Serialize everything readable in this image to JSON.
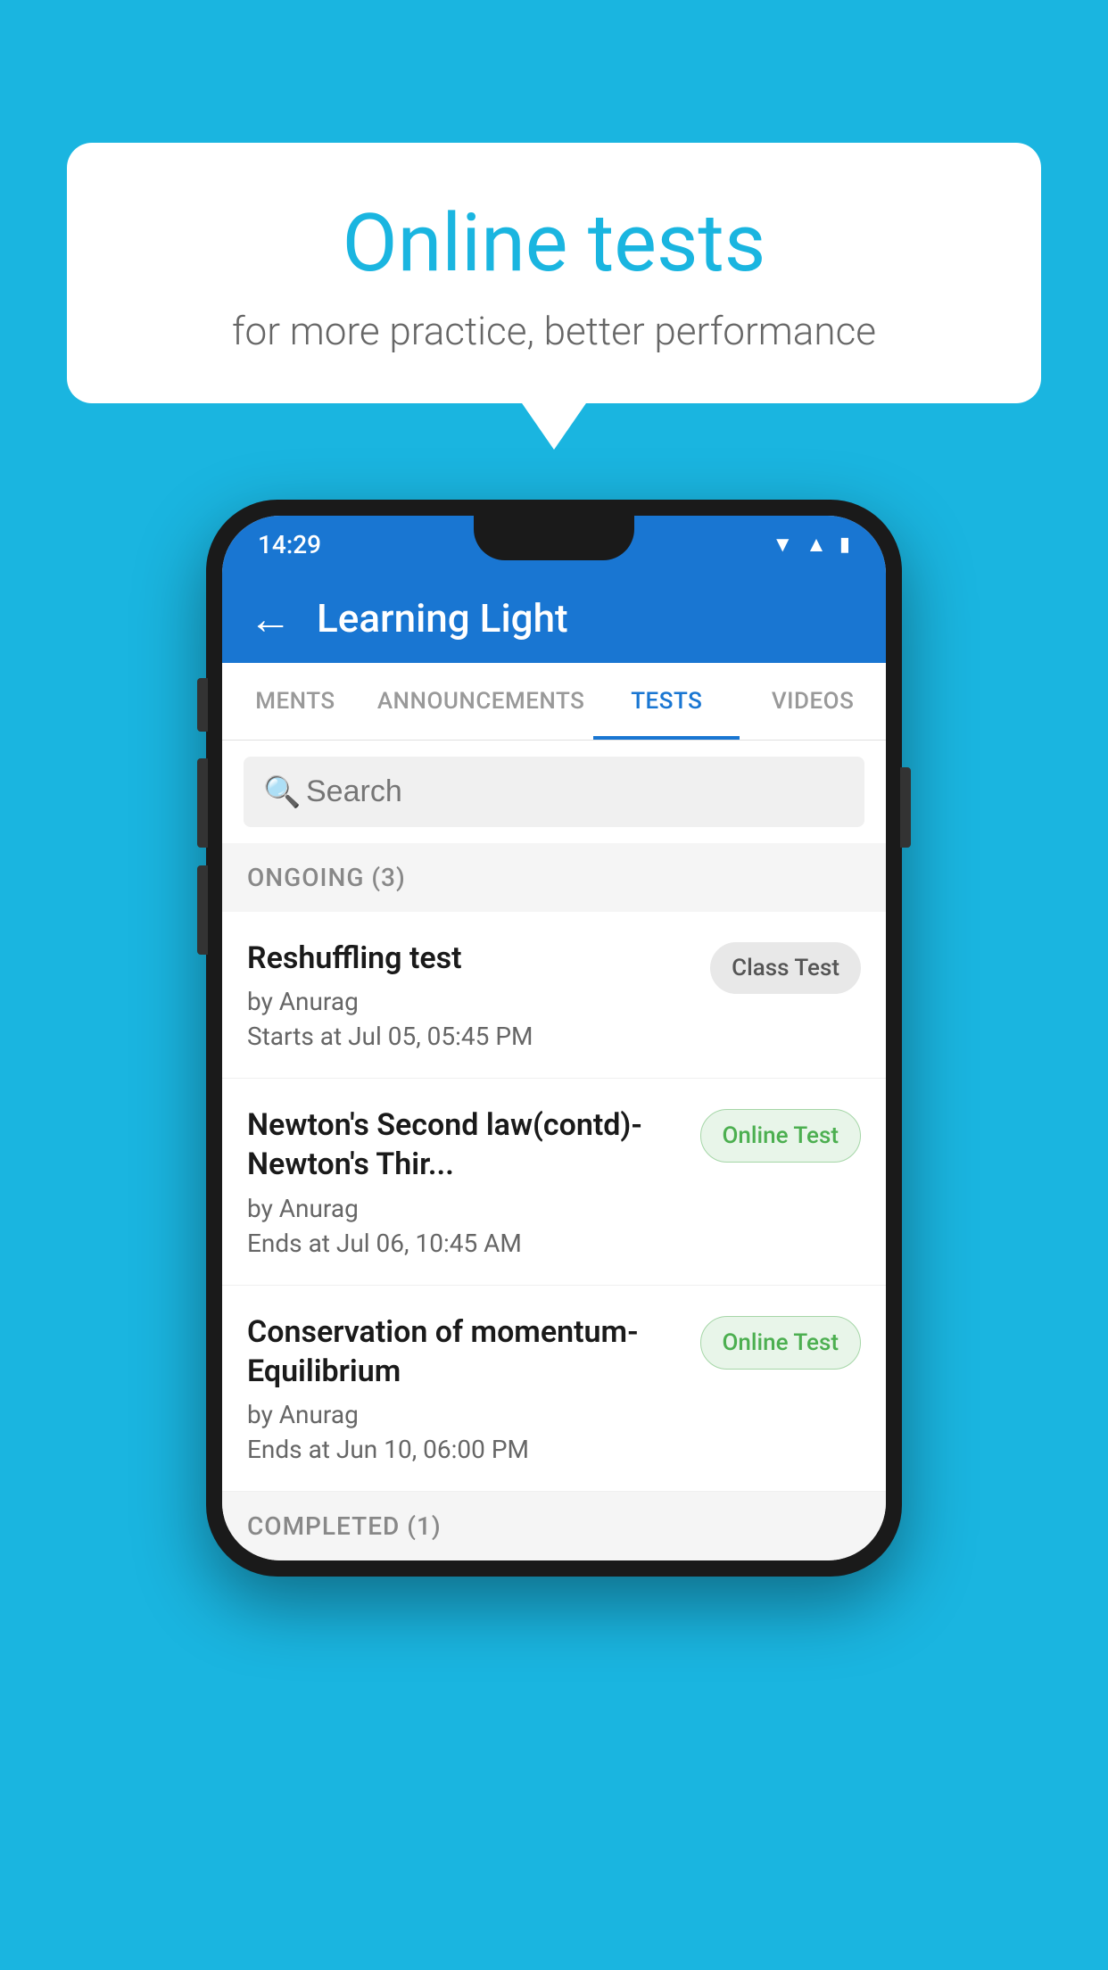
{
  "background": {
    "color": "#1ab5e0"
  },
  "bubble": {
    "title": "Online tests",
    "subtitle": "for more practice, better performance"
  },
  "phone": {
    "status_bar": {
      "time": "14:29",
      "icons": [
        "wifi",
        "signal",
        "battery"
      ]
    },
    "header": {
      "back_label": "←",
      "title": "Learning Light"
    },
    "tabs": [
      {
        "label": "MENTS",
        "active": false
      },
      {
        "label": "ANNOUNCEMENTS",
        "active": false
      },
      {
        "label": "TESTS",
        "active": true
      },
      {
        "label": "VIDEOS",
        "active": false
      }
    ],
    "search": {
      "placeholder": "Search"
    },
    "sections": [
      {
        "header": "ONGOING (3)",
        "items": [
          {
            "name": "Reshuffling test",
            "author": "by Anurag",
            "time_label": "Starts at",
            "time": "Jul 05, 05:45 PM",
            "badge": "Class Test",
            "badge_type": "class"
          },
          {
            "name": "Newton's Second law(contd)-Newton's Thir...",
            "author": "by Anurag",
            "time_label": "Ends at",
            "time": "Jul 06, 10:45 AM",
            "badge": "Online Test",
            "badge_type": "online"
          },
          {
            "name": "Conservation of momentum-Equilibrium",
            "author": "by Anurag",
            "time_label": "Ends at",
            "time": "Jun 10, 06:00 PM",
            "badge": "Online Test",
            "badge_type": "online"
          }
        ]
      }
    ],
    "completed_section": "COMPLETED (1)"
  }
}
